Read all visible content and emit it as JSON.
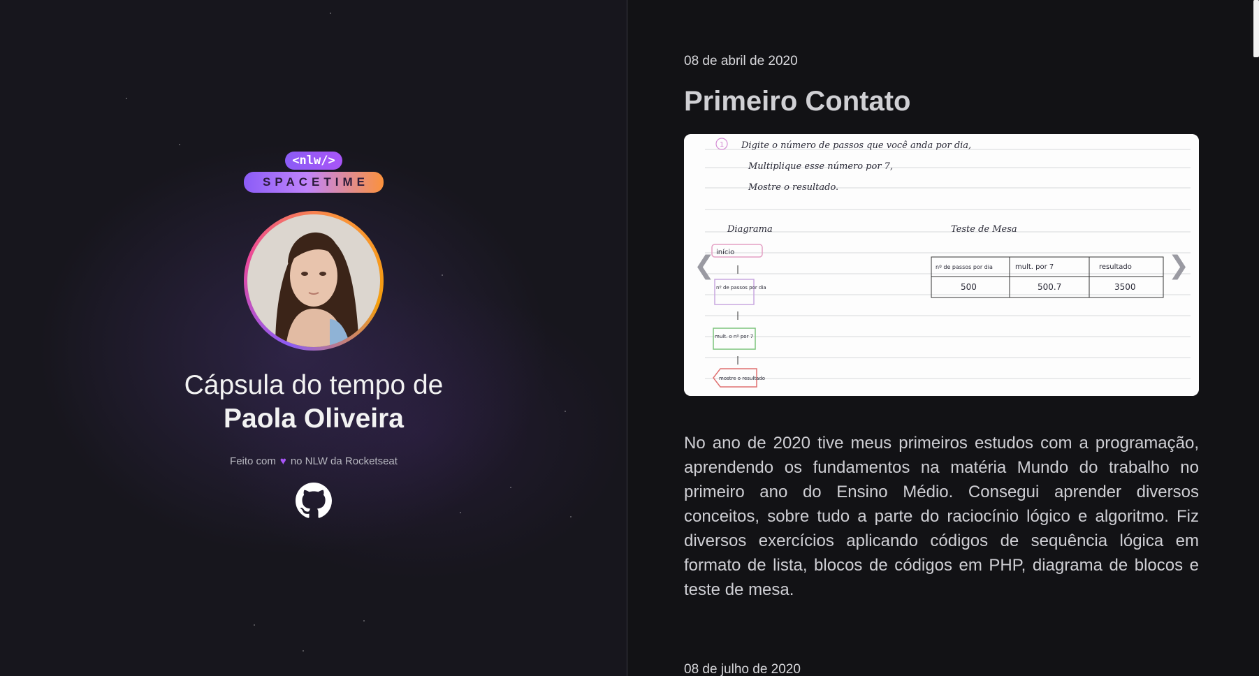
{
  "profile": {
    "logo_top": "<nlw/>",
    "logo_bottom": "SPACETIME",
    "title_line1": "Cápsula do tempo de",
    "name": "Paola Oliveira",
    "made_with_prefix": "Feito com",
    "made_with_suffix": "no NLW da Rocketseat",
    "heart_icon": "purple-heart",
    "github_icon": "github-icon"
  },
  "memories": [
    {
      "date": "08 de abril de 2020",
      "title": "Primeiro Contato",
      "image": {
        "notes": [
          "Digite o número de passos que você anda por dia,",
          "Multiplique esse número por 7,",
          "Mostre o resultado."
        ],
        "diagram_label": "Diagrama",
        "table_label": "Teste de Mesa",
        "flow": [
          "início",
          "nº de passos por dia",
          "mult. o nº por 7",
          "mostre o resultado"
        ],
        "table_headers": [
          "nº de passos por dia",
          "mult. por 7",
          "resultado"
        ],
        "table_row": [
          "500",
          "500.7",
          "3500"
        ]
      },
      "text": "No ano de 2020 tive meus primeiros estudos com a programação, aprendendo os fundamentos na matéria Mundo do trabalho no primeiro ano do Ensino Médio. Consegui aprender diversos conceitos, sobre tudo a parte do raciocínio lógico e algoritmo. Fiz diversos exercícios aplicando códigos de sequência lógica em formato de lista, blocos de códigos em PHP, diagrama de blocos e teste de mesa."
    },
    {
      "date": "08 de julho de 2020"
    }
  ],
  "colors": {
    "accent_purple": "#8b5cf6",
    "accent_orange": "#fb923c",
    "background": "#121215"
  }
}
